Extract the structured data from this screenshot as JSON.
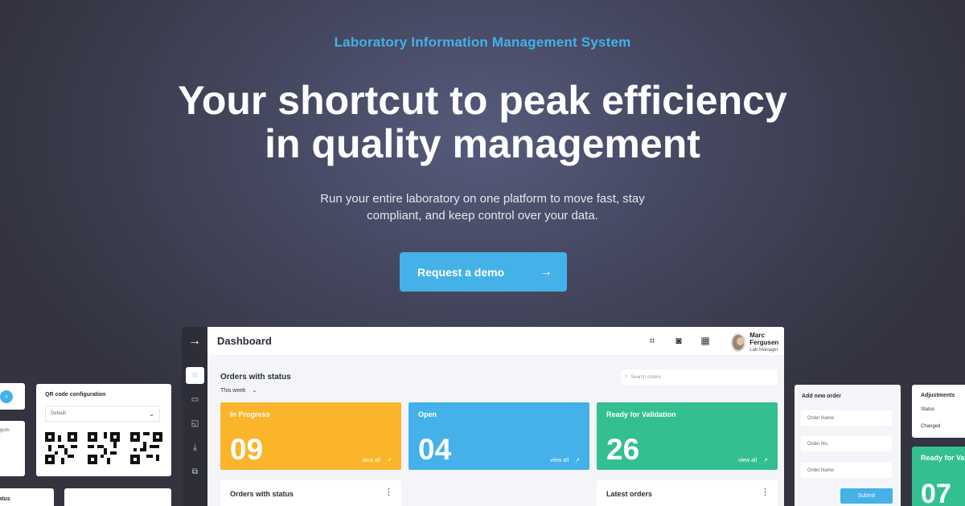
{
  "hero": {
    "eyebrow": "Laboratory Information Management System",
    "headline_line1": "Your shortcut to peak efficiency",
    "headline_line2": "in quality management",
    "sub_line1": "Run your entire laboratory on one platform to move fast, stay",
    "sub_line2": "compliant, and keep control over your data.",
    "cta_label": "Request a demo",
    "cta_icon": "arrow-right-icon"
  },
  "colors": {
    "accent": "#44b1e9",
    "in_progress": "#fbb52a",
    "open": "#44b1e9",
    "ready": "#33bf8f"
  },
  "dashboard": {
    "title": "Dashboard",
    "user_name": "Marc Fergusen",
    "user_role": "Lab Manager",
    "header_icons": [
      "qr-scan-icon",
      "camera-icon",
      "calendar-icon"
    ],
    "section_title": "Orders with status",
    "period": "This week",
    "search_placeholder": "Search orders",
    "cards": [
      {
        "label": "In Progress",
        "count": "09",
        "link": "view all"
      },
      {
        "label": "Open",
        "count": "04",
        "link": "view all"
      },
      {
        "label": "Ready for Validation",
        "count": "26",
        "link": "view all"
      }
    ],
    "panels": [
      {
        "title": "Orders with status"
      },
      {
        "title": "Latest orders"
      }
    ],
    "rail_icons": [
      "star-icon",
      "calendar-icon",
      "note-icon",
      "download-icon",
      "copy-icon"
    ]
  },
  "widgets": {
    "qr": {
      "title": "QR code configuration",
      "select_value": "Default"
    },
    "partial_left": {
      "text1": "gum",
      "text2": "tatus"
    },
    "add_order": {
      "title": "Add new order",
      "placeholders": [
        "Order Name",
        "Order No.",
        "Order Name"
      ],
      "submit": "Submit"
    },
    "adjustments": {
      "title": "Adjustments",
      "status": "Status",
      "changed": "Changed"
    },
    "ready_partial": {
      "label": "Ready for Va",
      "count": "07"
    }
  }
}
